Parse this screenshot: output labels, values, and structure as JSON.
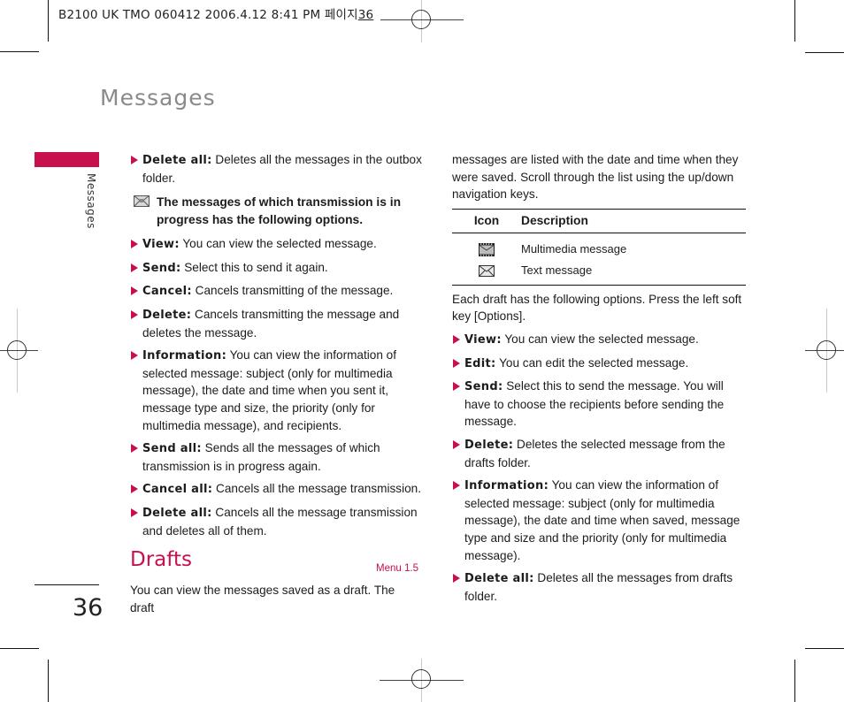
{
  "slug": {
    "text": "B2100 UK TMO 060412  2006.4.12 8:41 PM 페이지",
    "page": "36"
  },
  "header": {
    "section_title": "Messages",
    "side_label": "Messages"
  },
  "footer": {
    "page_number": "36"
  },
  "left_column": {
    "items_top": [
      {
        "term": "Delete all:",
        "desc": " Deletes all the messages in the outbox folder."
      }
    ],
    "note": {
      "icon": "envelope-sending-icon",
      "text": "The messages of which transmission is in progress has the following options."
    },
    "items": [
      {
        "term": "View:",
        "desc": " You can view the selected message."
      },
      {
        "term": "Send:",
        "desc": " Select this to send it again."
      },
      {
        "term": "Cancel:",
        "desc": " Cancels transmitting of the message."
      },
      {
        "term": "Delete:",
        "desc": " Cancels transmitting the message and deletes the message."
      },
      {
        "term": "Information:",
        "desc": " You can view the information of selected message: subject (only for multimedia message), the date and time when you sent it, message type and size, the priority (only for multimedia message), and recipients."
      },
      {
        "term": "Send all:",
        "desc": " Sends all the messages of which transmission is in progress again."
      },
      {
        "term": "Cancel all:",
        "desc": " Cancels all the message transmission."
      },
      {
        "term": "Delete all:",
        "desc": " Cancels all the message transmission and deletes all of them."
      }
    ],
    "drafts": {
      "title": "Drafts",
      "menu": "Menu 1.5",
      "intro": "You can view the messages saved as a draft. The draft"
    }
  },
  "right_column": {
    "intro": "messages are listed with the date and time when they were saved. Scroll through the list using the up/down navigation keys.",
    "table": {
      "headers": [
        "Icon",
        "Description"
      ],
      "rows": [
        {
          "icon": "multimedia-message-icon",
          "description": "Multimedia message"
        },
        {
          "icon": "text-message-icon",
          "description": "Text message"
        }
      ]
    },
    "options_intro": "Each draft has the following options. Press the left soft key [Options].",
    "items": [
      {
        "term": "View:",
        "desc": " You can view the selected message."
      },
      {
        "term": "Edit:",
        "desc": " You can edit the selected message."
      },
      {
        "term": "Send:",
        "desc": " Select this to send the message. You will have to choose the recipients before sending the message."
      },
      {
        "term": "Delete:",
        "desc": " Deletes the selected message from the drafts folder."
      },
      {
        "term": "Information:",
        "desc": " You can view the information of selected message: subject (only for multimedia message), the date and time when saved, message type and size and the priority (only for multimedia message)."
      },
      {
        "term": "Delete all:",
        "desc": " Deletes all the messages from drafts folder."
      }
    ]
  },
  "colors": {
    "accent": "#c8104e",
    "section_title": "#8a8a8a"
  }
}
